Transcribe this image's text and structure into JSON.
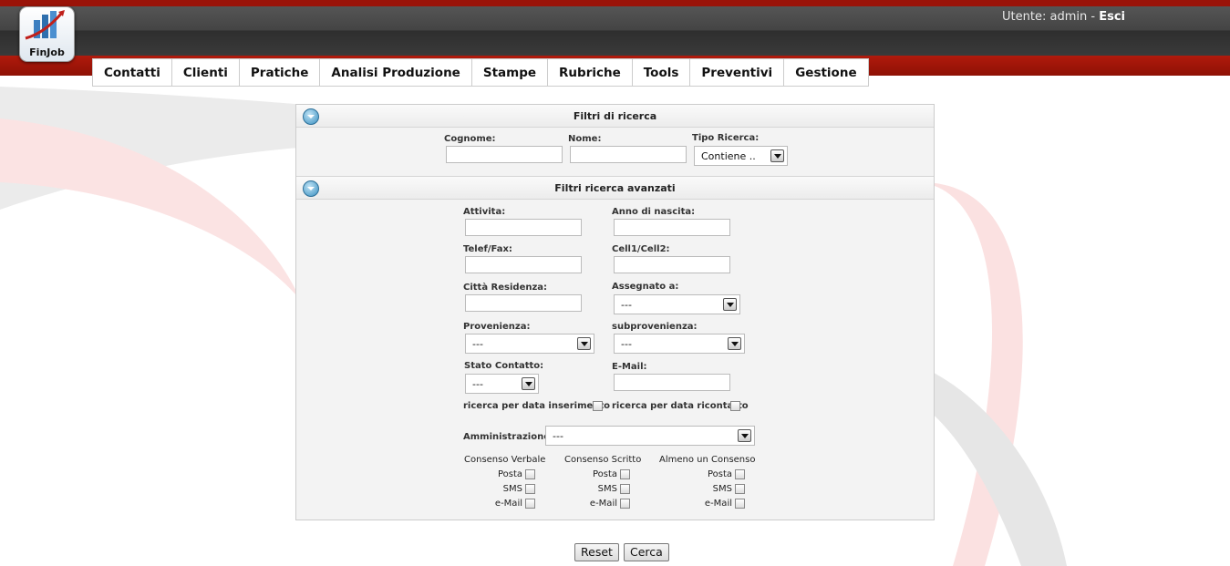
{
  "header": {
    "logo_text": "FinJob",
    "user_prefix": "Utente: ",
    "user_name": "admin",
    "separator": " - ",
    "logout_label": "Esci"
  },
  "menu": {
    "items": [
      "Contatti",
      "Clienti",
      "Pratiche",
      "Analisi Produzione",
      "Stampe",
      "Rubriche",
      "Tools",
      "Preventivi",
      "Gestione"
    ]
  },
  "filters": {
    "title": "Filtri di ricerca",
    "cognome_label": "Cognome:",
    "nome_label": "Nome:",
    "tipo_label": "Tipo Ricerca:",
    "tipo_value": "Contiene .."
  },
  "advanced": {
    "title": "Filtri ricerca avanzati",
    "attivita_label": "Attivita:",
    "anno_label": "Anno di nascita:",
    "telef_label": "Telef/Fax:",
    "cell_label": "Cell1/Cell2:",
    "citta_label": "Città Residenza:",
    "assegnato_label": "Assegnato a:",
    "assegnato_value": "---",
    "provenienza_label": "Provenienza:",
    "provenienza_value": "---",
    "subprovenienza_label": "subprovenienza:",
    "subprovenienza_value": "---",
    "stato_label": "Stato Contatto:",
    "stato_value": "---",
    "email_label": "E-Mail:",
    "data_ins_label": "ricerca per data inserimento",
    "data_ric_label": "ricerca per data ricontatto",
    "amministrazione_label": "Amministrazione:",
    "amministrazione_value": "---"
  },
  "consensi": {
    "groups": [
      "Consenso Verbale",
      "Consenso Scritto",
      "Almeno un Consenso"
    ],
    "posta": "Posta",
    "sms": "SMS",
    "email": "e-Mail"
  },
  "actions": {
    "reset_label": "Reset",
    "cerca_label": "Cerca"
  },
  "colors": {
    "brand_red": "#9a1308",
    "header_dark": "#3a3a3a",
    "panel_bg": "#f3f3f3"
  }
}
